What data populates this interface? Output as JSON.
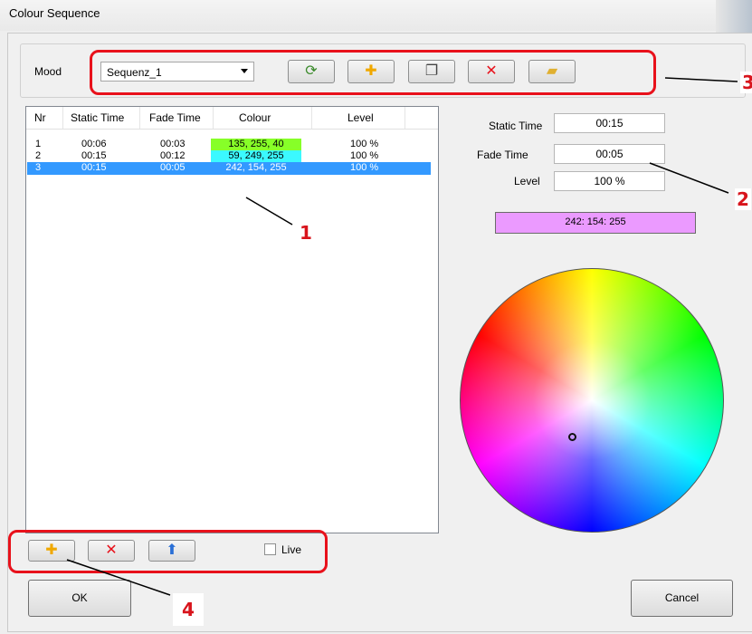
{
  "window": {
    "title": "Colour Sequence"
  },
  "mood": {
    "label": "Mood",
    "selected": "Sequenz_1"
  },
  "toolbar": {
    "buttons": [
      {
        "name": "refresh-colours-button",
        "icon": "colour-refresh-icon",
        "glyph": "⟳",
        "color": "#3a8a2a"
      },
      {
        "name": "add-mood-button",
        "icon": "plus-icon",
        "glyph": "✚",
        "color": "#f0a800"
      },
      {
        "name": "copy-mood-button",
        "icon": "copy-icon",
        "glyph": "❐",
        "color": "#444444"
      },
      {
        "name": "delete-mood-button",
        "icon": "delete-x-icon",
        "glyph": "✕",
        "color": "#e8111b"
      },
      {
        "name": "open-folder-button",
        "icon": "folder-open-icon",
        "glyph": "▰",
        "color": "#e0b030"
      }
    ]
  },
  "table": {
    "headers": [
      "Nr",
      "Static Time",
      "Fade Time",
      "Colour",
      "Level"
    ],
    "rows": [
      {
        "nr": "1",
        "static": "00:06",
        "fade": "00:03",
        "colour": "135, 255, 40",
        "level": "100 %",
        "swatch": "#87ff28"
      },
      {
        "nr": "2",
        "static": "00:15",
        "fade": "00:12",
        "colour": "59, 249, 255",
        "level": "100 %",
        "swatch": "#3bf9ff"
      },
      {
        "nr": "3",
        "static": "00:15",
        "fade": "00:05",
        "colour": "242, 154, 255",
        "level": "100 %",
        "swatch": "#3399ff"
      }
    ]
  },
  "details": {
    "static_label": "Static Time",
    "static_value": "00:15",
    "fade_label": "Fade Time",
    "fade_value": "00:05",
    "level_label": "Level",
    "level_value": "100 %",
    "colour_value": "242: 154: 255"
  },
  "bottom": {
    "live_label": "Live"
  },
  "buttons": {
    "ok": "OK",
    "cancel": "Cancel"
  },
  "callouts": {
    "c1": "1",
    "c2": "2",
    "c3": "3",
    "c4": "4"
  },
  "colors": {
    "highlight": "#e8111b",
    "selection": "#3399ff",
    "current_colour": "#eb9aff"
  }
}
